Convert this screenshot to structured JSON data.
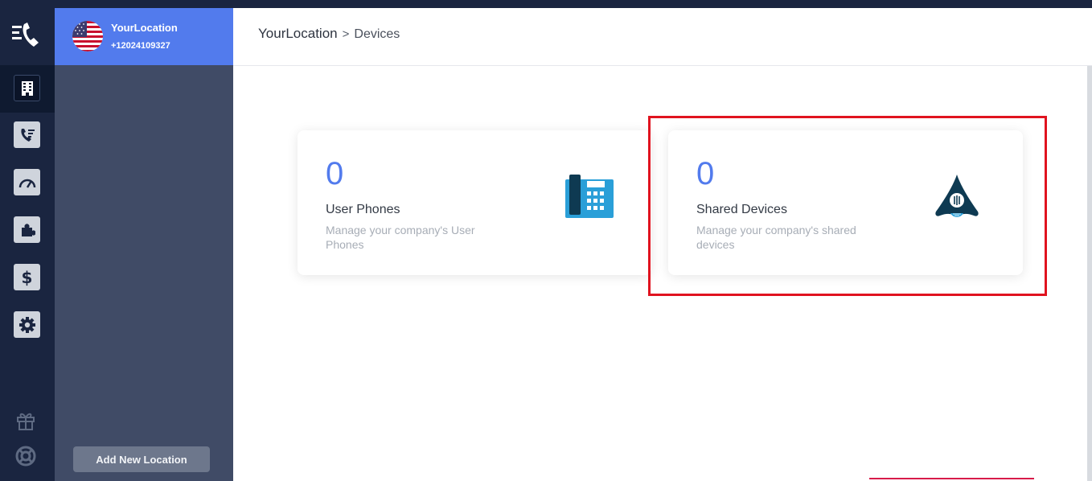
{
  "location": {
    "name": "YourLocation",
    "phone": "+12024109327"
  },
  "breadcrumb": {
    "root": "YourLocation",
    "separator": ">",
    "current": "Devices"
  },
  "sidebar": {
    "icons": [
      "building-icon",
      "call-log-icon",
      "dashboard-gauge-icon",
      "integrations-puzzle-icon",
      "billing-dollar-icon",
      "settings-gear-icon",
      "gift-icon",
      "help-lifebuoy-icon"
    ],
    "add_location_label": "Add New Location"
  },
  "cards": [
    {
      "count": "0",
      "title": "User Phones",
      "description": "Manage your company's User Phones",
      "icon": "desk-phone-icon"
    },
    {
      "count": "0",
      "title": "Shared Devices",
      "description": "Manage your company's shared devices",
      "icon": "conference-phone-icon"
    }
  ],
  "colors": {
    "accent": "#527bed",
    "rail": "#1a2540",
    "panel": "#404b66",
    "highlight": "#e0131f"
  }
}
